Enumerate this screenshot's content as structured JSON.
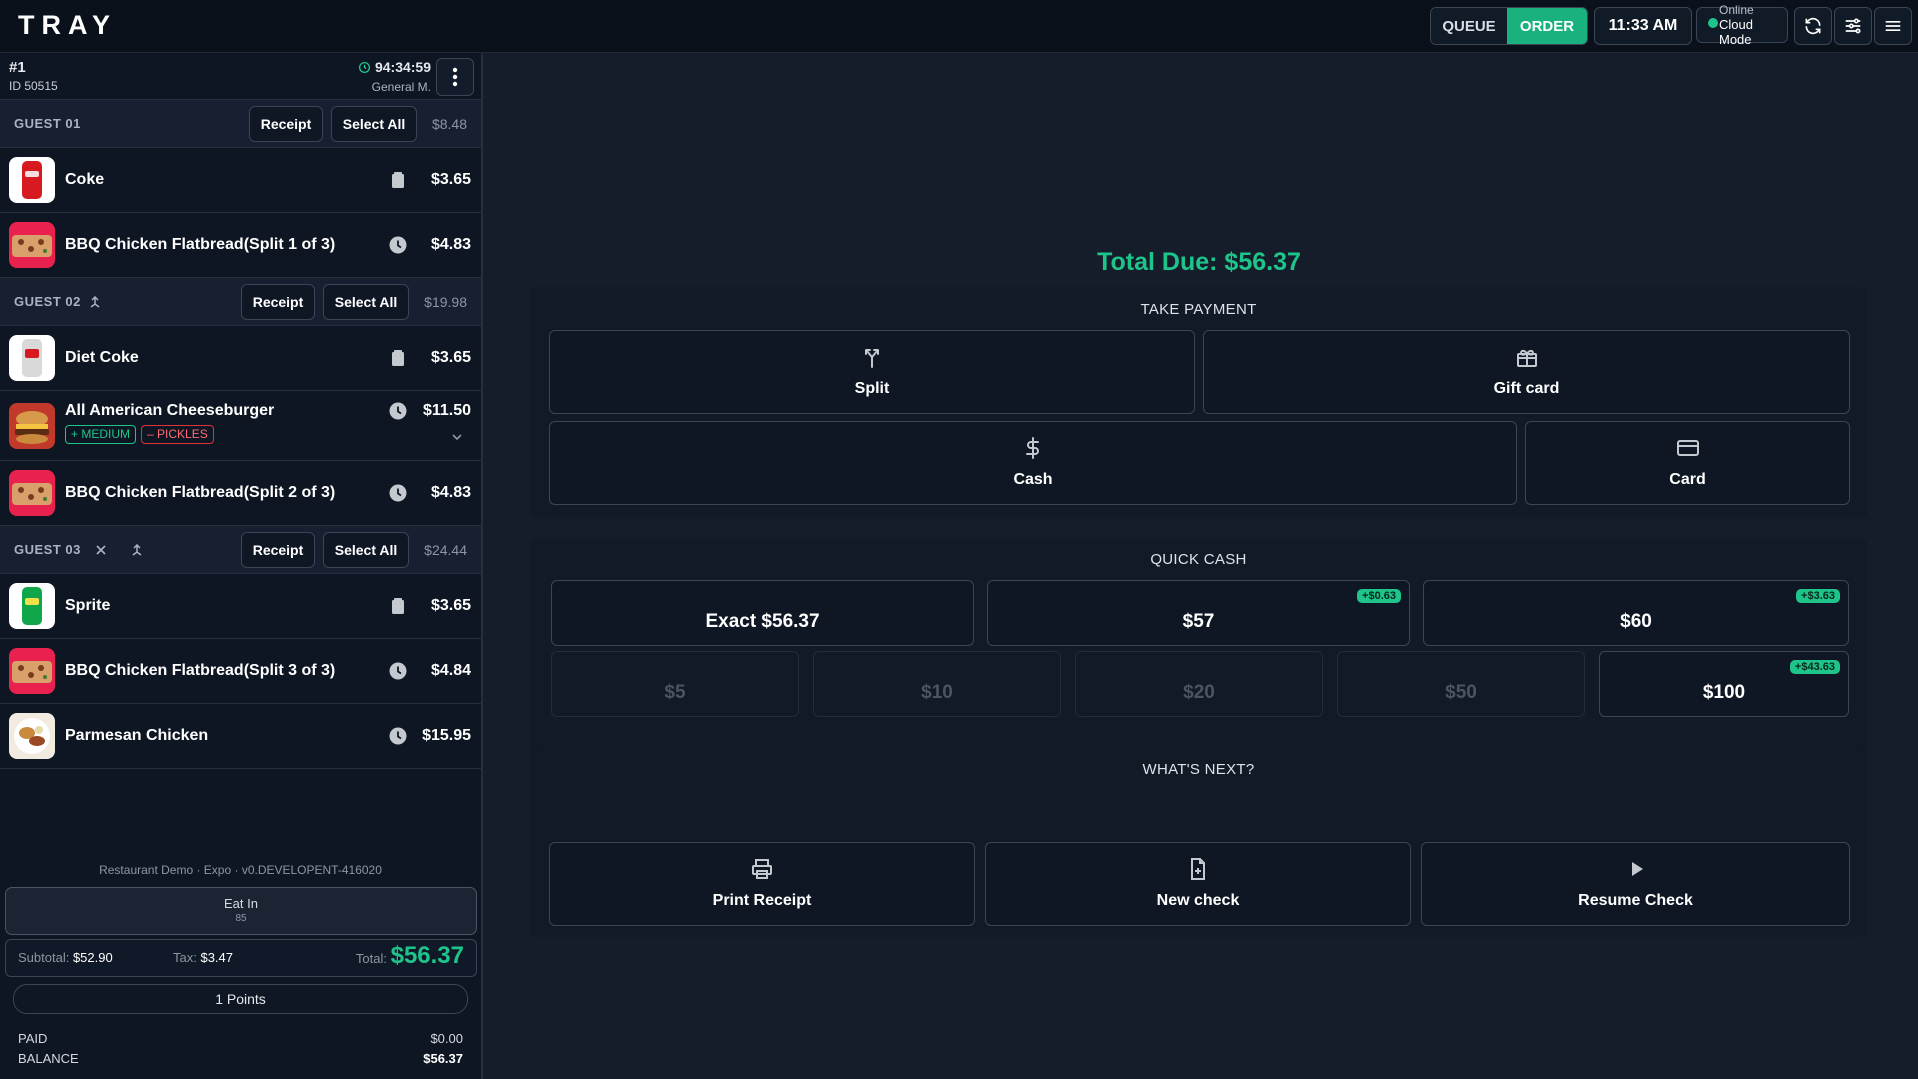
{
  "app": {
    "brand": "TRAY",
    "modes": {
      "queue": "QUEUE",
      "order": "ORDER"
    },
    "time": "11:33 AM",
    "status": {
      "line1": "Online",
      "line2": "Cloud Mode"
    },
    "icons": [
      "refresh-icon",
      "sliders-icon",
      "menu-icon"
    ]
  },
  "order": {
    "number": "#1",
    "id": "ID 50515",
    "timer": "94:34:59",
    "server": "General M.",
    "guests": [
      {
        "title": "GUEST 01",
        "receipt": "Receipt",
        "select_all": "Select All",
        "total": "$8.48",
        "items": [
          {
            "name": "Coke",
            "price": "$3.65",
            "status_icon": "bag-icon"
          },
          {
            "name": "BBQ Chicken Flatbread(Split 1 of 3)",
            "price": "$4.83",
            "status_icon": "clock-icon"
          }
        ]
      },
      {
        "title": "GUEST 02",
        "receipt": "Receipt",
        "select_all": "Select All",
        "total": "$19.98",
        "items": [
          {
            "name": "Diet Coke",
            "price": "$3.65",
            "status_icon": "bag-icon"
          },
          {
            "name": "All American Cheeseburger",
            "price": "$11.50",
            "status_icon": "clock-icon",
            "mods": [
              "+ MEDIUM",
              "– PICKLES"
            ]
          },
          {
            "name": "BBQ Chicken Flatbread(Split 2 of 3)",
            "price": "$4.83",
            "status_icon": "clock-icon"
          }
        ]
      },
      {
        "title": "GUEST 03",
        "receipt": "Receipt",
        "select_all": "Select All",
        "total": "$24.44",
        "items": [
          {
            "name": "Sprite",
            "price": "$3.65",
            "status_icon": "bag-icon"
          },
          {
            "name": "BBQ Chicken Flatbread(Split 3 of 3)",
            "price": "$4.84",
            "status_icon": "clock-icon"
          },
          {
            "name": "Parmesan Chicken",
            "price": "$15.95",
            "status_icon": "clock-icon"
          }
        ]
      }
    ],
    "version": "Restaurant Demo · Expo · v0.DEVELOPENT-416020",
    "dining": {
      "label": "Eat In",
      "code": "85"
    },
    "subtotal_label": "Subtotal:",
    "subtotal": "$52.90",
    "tax_label": "Tax:",
    "tax": "$3.47",
    "total_label": "Total:",
    "total": "$56.37",
    "points": "1  Points",
    "paid_label": "PAID",
    "paid": "$0.00",
    "balance_label": "BALANCE",
    "balance": "$56.37"
  },
  "payment": {
    "total_due": "Total Due: $56.37",
    "take_payment": {
      "title": "TAKE PAYMENT",
      "split": "Split",
      "gift_card": "Gift card",
      "cash": "Cash",
      "card": "Card"
    },
    "quick_cash": {
      "title": "QUICK CASH",
      "exact": "Exact $56.37",
      "b57": "$57",
      "b57_change": "+$0.63",
      "b60": "$60",
      "b60_change": "+$3.63",
      "b5": "$5",
      "b10": "$10",
      "b20": "$20",
      "b50": "$50",
      "b100": "$100",
      "b100_change": "+$43.63"
    },
    "next": {
      "title": "WHAT'S NEXT?",
      "print": "Print Receipt",
      "new_check": "New check",
      "resume": "Resume Check"
    }
  },
  "colors": {
    "accent": "#1ec48a",
    "background": "#151d2a",
    "panel": "#0e1623",
    "danger": "#e0323a"
  }
}
